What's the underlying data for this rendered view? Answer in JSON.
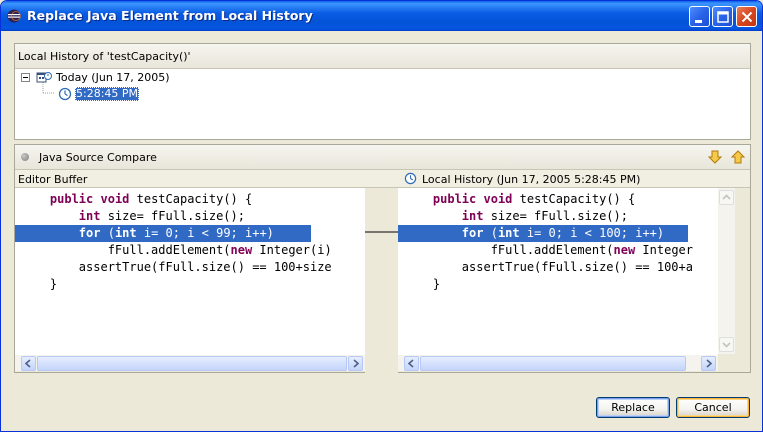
{
  "window": {
    "title": "Replace Java Element from Local History"
  },
  "local_history": {
    "header": "Local History of 'testCapacity()'",
    "tree": [
      {
        "label": "Today (Jun 17, 2005)",
        "icon": "calendar-icon",
        "expanded": true
      },
      {
        "label": "5:28:45 PM",
        "icon": "clock-icon",
        "selected": true
      }
    ]
  },
  "compare": {
    "title": "Java Source Compare",
    "left_header": "Editor Buffer",
    "right_header": "Local History (Jun 17, 2005 5:28:45 PM)",
    "nav": {
      "next_icon": "next-difference-icon",
      "prev_icon": "previous-difference-icon"
    },
    "left_code": [
      {
        "segments": [
          {
            "t": "    "
          },
          {
            "t": "public",
            "kw": true
          },
          {
            "t": " "
          },
          {
            "t": "void",
            "kw": true
          },
          {
            "t": " testCapacity() {"
          }
        ]
      },
      {
        "segments": [
          {
            "t": "        "
          },
          {
            "t": "int",
            "kw": true
          },
          {
            "t": " size= fFull.size();"
          }
        ]
      },
      {
        "segments": [
          {
            "t": "        "
          },
          {
            "t": "for",
            "kw": true
          },
          {
            "t": " ("
          },
          {
            "t": "int",
            "kw": true
          },
          {
            "t": " i= 0; i < 99; i++)"
          }
        ],
        "highlight": true
      },
      {
        "segments": [
          {
            "t": "            fFull.addElement("
          },
          {
            "t": "new",
            "kw": true
          },
          {
            "t": " Integer(i)"
          }
        ]
      },
      {
        "segments": [
          {
            "t": "        assertTrue(fFull.size() == 100+size"
          }
        ]
      },
      {
        "segments": [
          {
            "t": "    }"
          }
        ]
      }
    ],
    "right_code": [
      {
        "segments": [
          {
            "t": "    "
          },
          {
            "t": "public",
            "kw": true
          },
          {
            "t": " "
          },
          {
            "t": "void",
            "kw": true
          },
          {
            "t": " testCapacity() {"
          }
        ]
      },
      {
        "segments": [
          {
            "t": "        "
          },
          {
            "t": "int",
            "kw": true
          },
          {
            "t": " size= fFull.size();"
          }
        ]
      },
      {
        "segments": [
          {
            "t": "        "
          },
          {
            "t": "for",
            "kw": true
          },
          {
            "t": " ("
          },
          {
            "t": "int",
            "kw": true
          },
          {
            "t": " i= 0; i < 100; i++)"
          }
        ],
        "highlight": true
      },
      {
        "segments": [
          {
            "t": "            fFull.addElement("
          },
          {
            "t": "new",
            "kw": true
          },
          {
            "t": " Integer"
          }
        ]
      },
      {
        "segments": [
          {
            "t": "        assertTrue(fFull.size() == 100+a"
          }
        ]
      },
      {
        "segments": [
          {
            "t": "    }"
          }
        ]
      }
    ]
  },
  "buttons": {
    "replace": "Replace",
    "cancel": "Cancel"
  },
  "colors": {
    "selection": "#316ac5",
    "keyword": "#7f0055",
    "titlebar": "#0a5de5"
  }
}
